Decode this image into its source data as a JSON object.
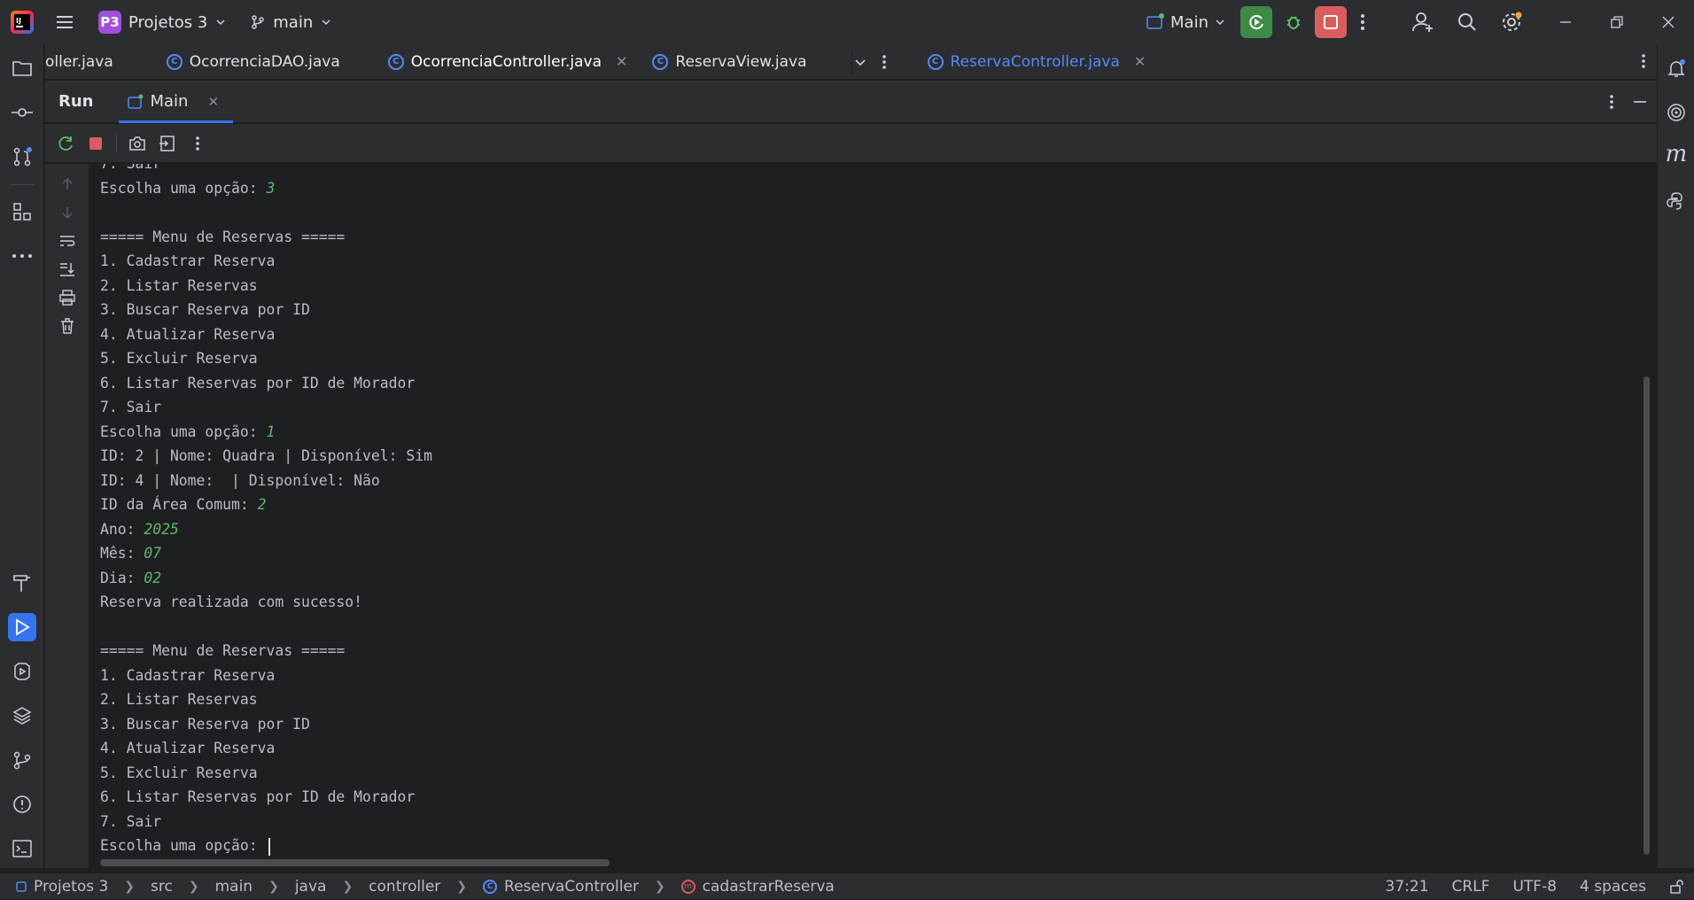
{
  "titlebar": {
    "project_badge": "P3",
    "project_name": "Projetos 3",
    "branch": "main",
    "run_config": "Main"
  },
  "tabs": [
    {
      "label": "oller.java"
    },
    {
      "label": "OcorrenciaDAO.java"
    },
    {
      "label": "OcorrenciaController.java"
    },
    {
      "label": "ReservaView.java"
    },
    {
      "label": "ReservaController.java"
    }
  ],
  "run_panel": {
    "title": "Run",
    "tab_label": "Main"
  },
  "console": {
    "lines": [
      {
        "text": "7. Sair",
        "input": ""
      },
      {
        "text": "Escolha uma opção: ",
        "input": "3"
      },
      {
        "text": "",
        "input": ""
      },
      {
        "text": "===== Menu de Reservas =====",
        "input": ""
      },
      {
        "text": "1. Cadastrar Reserva",
        "input": ""
      },
      {
        "text": "2. Listar Reservas",
        "input": ""
      },
      {
        "text": "3. Buscar Reserva por ID",
        "input": ""
      },
      {
        "text": "4. Atualizar Reserva",
        "input": ""
      },
      {
        "text": "5. Excluir Reserva",
        "input": ""
      },
      {
        "text": "6. Listar Reservas por ID de Morador",
        "input": ""
      },
      {
        "text": "7. Sair",
        "input": ""
      },
      {
        "text": "Escolha uma opção: ",
        "input": "1"
      },
      {
        "text": "ID: 2 | Nome: Quadra | Disponível: Sim",
        "input": ""
      },
      {
        "text": "ID: 4 | Nome:  | Disponível: Não",
        "input": ""
      },
      {
        "text": "ID da Área Comum: ",
        "input": "2"
      },
      {
        "text": "Ano: ",
        "input": "2025"
      },
      {
        "text": "Mês: ",
        "input": "07"
      },
      {
        "text": "Dia: ",
        "input": "02"
      },
      {
        "text": "Reserva realizada com sucesso!",
        "input": ""
      },
      {
        "text": "",
        "input": ""
      },
      {
        "text": "===== Menu de Reservas =====",
        "input": ""
      },
      {
        "text": "1. Cadastrar Reserva",
        "input": ""
      },
      {
        "text": "2. Listar Reservas",
        "input": ""
      },
      {
        "text": "3. Buscar Reserva por ID",
        "input": ""
      },
      {
        "text": "4. Atualizar Reserva",
        "input": ""
      },
      {
        "text": "5. Excluir Reserva",
        "input": ""
      },
      {
        "text": "6. Listar Reservas por ID de Morador",
        "input": ""
      },
      {
        "text": "7. Sair",
        "input": ""
      },
      {
        "text": "Escolha uma opção: ",
        "input": ""
      }
    ]
  },
  "statusbar": {
    "breadcrumbs": [
      "Projetos 3",
      "src",
      "main",
      "java",
      "controller",
      "ReservaController",
      "cadastrarReserva"
    ],
    "position": "37:21",
    "line_ending": "CRLF",
    "encoding": "UTF-8",
    "indent": "4 spaces"
  },
  "colors": {
    "accent": "#3574f0",
    "input_text": "#5fb865",
    "stop_red": "#db5c5c",
    "run_green": "#3f8a46"
  }
}
